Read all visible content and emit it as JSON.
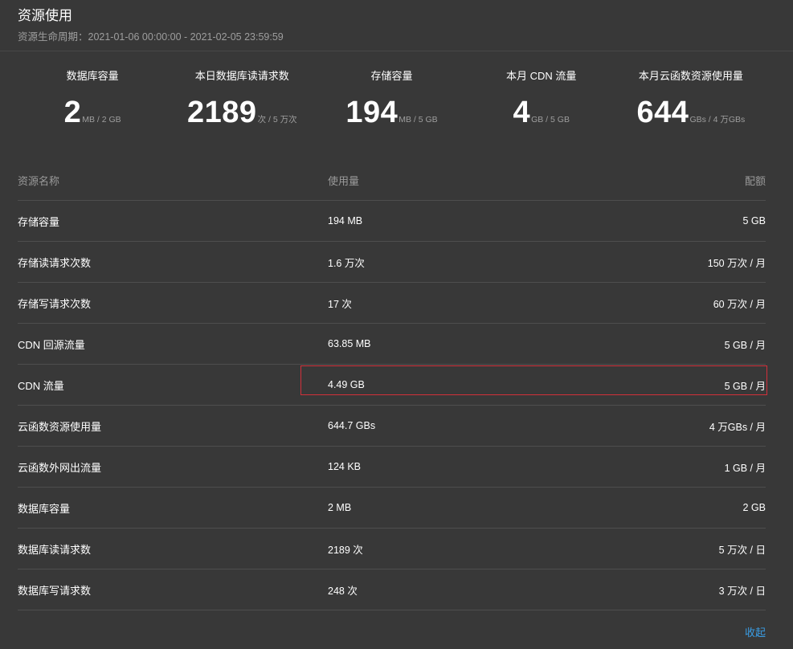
{
  "header": {
    "title": "资源使用",
    "lifecycle": "资源生命周期：2021-01-06 00:00:00 - 2021-02-05 23:59:59"
  },
  "stats": [
    {
      "label": "数据库容量",
      "value": "2",
      "unit": "MB / 2 GB"
    },
    {
      "label": "本日数据库读请求数",
      "value": "2189",
      "unit": "次 / 5 万次"
    },
    {
      "label": "存储容量",
      "value": "194",
      "unit": "MB / 5 GB"
    },
    {
      "label": "本月 CDN 流量",
      "value": "4",
      "unit": "GB / 5 GB"
    },
    {
      "label": "本月云函数资源使用量",
      "value": "644",
      "unit": "GBs / 4 万GBs"
    }
  ],
  "table": {
    "columns": {
      "name": "资源名称",
      "usage": "使用量",
      "quota": "配额"
    },
    "rows": [
      {
        "name": "存储容量",
        "usage": "194 MB",
        "quota": "5 GB"
      },
      {
        "name": "存储读请求次数",
        "usage": "1.6 万次",
        "quota": "150 万次 / 月"
      },
      {
        "name": "存储写请求次数",
        "usage": "17 次",
        "quota": "60 万次 / 月"
      },
      {
        "name": "CDN 回源流量",
        "usage": "63.85 MB",
        "quota": "5 GB / 月"
      },
      {
        "name": "CDN 流量",
        "usage": "4.49 GB",
        "quota": "5 GB / 月"
      },
      {
        "name": "云函数资源使用量",
        "usage": "644.7 GBs",
        "quota": "4 万GBs / 月"
      },
      {
        "name": "云函数外网出流量",
        "usage": "124 KB",
        "quota": "1 GB / 月"
      },
      {
        "name": "数据库容量",
        "usage": "2 MB",
        "quota": "2 GB"
      },
      {
        "name": "数据库读请求数",
        "usage": "2189 次",
        "quota": "5 万次 / 日"
      },
      {
        "name": "数据库写请求数",
        "usage": "248 次",
        "quota": "3 万次 / 日"
      }
    ]
  },
  "collapse_label": "收起",
  "colors": {
    "background": "#383838",
    "highlight": "#d2303a",
    "link": "#3a9ee6"
  }
}
